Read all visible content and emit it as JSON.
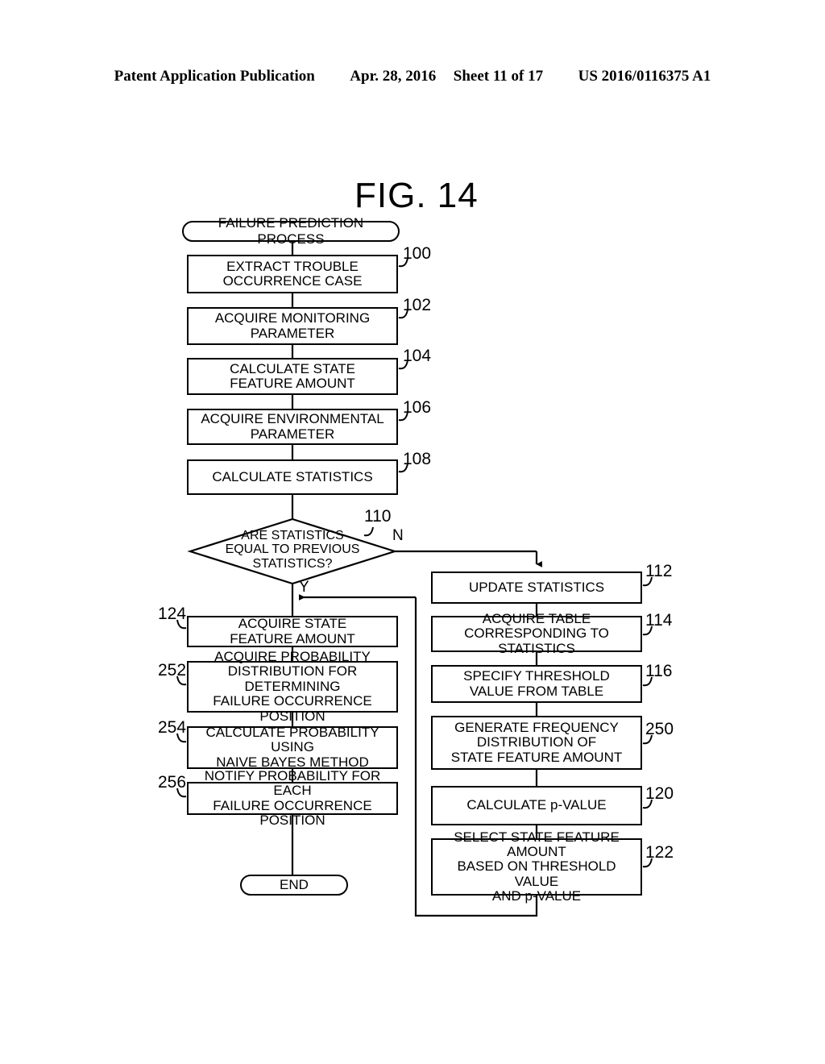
{
  "header": {
    "publication": "Patent Application Publication",
    "date": "Apr. 28, 2016",
    "sheet": "Sheet 11 of 17",
    "docnum": "US 2016/0116375 A1"
  },
  "figure": {
    "title": "FIG. 14",
    "start_label": "FAILURE PREDICTION PROCESS",
    "end_label": "END",
    "branch_yes": "Y",
    "branch_no": "N",
    "decision": {
      "ref": "110",
      "text": "ARE STATISTICS\nEQUAL TO PREVIOUS\nSTATISTICS?"
    },
    "main_steps": [
      {
        "ref": "100",
        "text": "EXTRACT TROUBLE\nOCCURRENCE CASE"
      },
      {
        "ref": "102",
        "text": "ACQUIRE MONITORING\nPARAMETER"
      },
      {
        "ref": "104",
        "text": "CALCULATE STATE\nFEATURE AMOUNT"
      },
      {
        "ref": "106",
        "text": "ACQUIRE ENVIRONMENTAL\nPARAMETER"
      },
      {
        "ref": "108",
        "text": "CALCULATE STATISTICS"
      }
    ],
    "yes_branch_steps": [
      {
        "ref": "124",
        "text": "ACQUIRE STATE\nFEATURE AMOUNT"
      },
      {
        "ref": "252",
        "text": "ACQUIRE PROBABILITY\nDISTRIBUTION FOR DETERMINING\nFAILURE OCCURRENCE POSITION"
      },
      {
        "ref": "254",
        "text": "CALCULATE PROBABILITY USING\nNAIVE BAYES METHOD"
      },
      {
        "ref": "256",
        "text": "NOTIFY PROBABILITY FOR EACH\nFAILURE OCCURRENCE POSITION"
      }
    ],
    "no_branch_steps": [
      {
        "ref": "112",
        "text": "UPDATE STATISTICS"
      },
      {
        "ref": "114",
        "text": "ACQUIRE TABLE\nCORRESPONDING TO STATISTICS"
      },
      {
        "ref": "116",
        "text": "SPECIFY THRESHOLD\nVALUE FROM TABLE"
      },
      {
        "ref": "250",
        "text": "GENERATE FREQUENCY\nDISTRIBUTION OF\nSTATE FEATURE AMOUNT"
      },
      {
        "ref": "120",
        "text": "CALCULATE p-VALUE"
      },
      {
        "ref": "122",
        "text": "SELECT STATE FEATURE AMOUNT\nBASED ON THRESHOLD VALUE\nAND p-VALUE"
      }
    ]
  }
}
